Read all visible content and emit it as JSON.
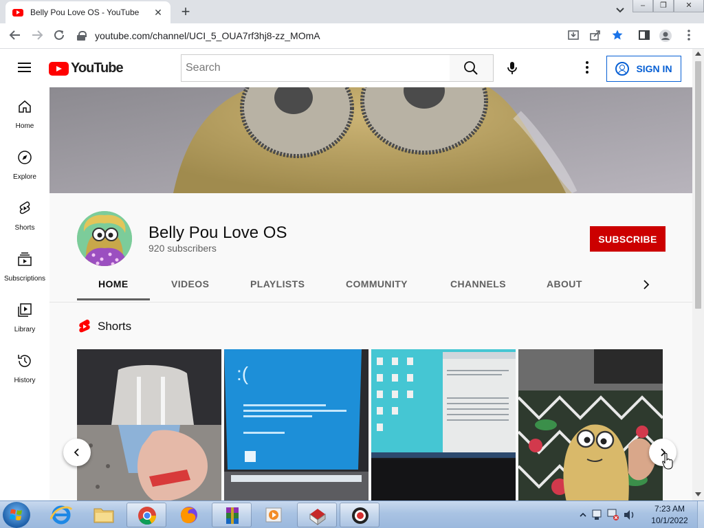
{
  "browser": {
    "tab_title": "Belly Pou Love OS - YouTube",
    "tab_close": "✕",
    "new_tab": "+",
    "url": "youtube.com/channel/UCI_5_OUA7rf3hj8-zz_MOmA"
  },
  "window_controls": {
    "minimize": "–",
    "restore": "❐",
    "close": "✕"
  },
  "youtube": {
    "logo_text": "YouTube",
    "search_placeholder": "Search",
    "sign_in": "SIGN IN"
  },
  "guide": [
    {
      "label": "Home",
      "icon": "home-icon"
    },
    {
      "label": "Explore",
      "icon": "compass-icon"
    },
    {
      "label": "Shorts",
      "icon": "shorts-icon"
    },
    {
      "label": "Subscriptions",
      "icon": "subscriptions-icon"
    },
    {
      "label": "Library",
      "icon": "library-icon"
    },
    {
      "label": "History",
      "icon": "history-icon"
    }
  ],
  "channel": {
    "name": "Belly Pou Love OS",
    "subscribers": "920 subscribers",
    "subscribe_label": "SUBSCRIBE",
    "tabs": [
      "HOME",
      "VIDEOS",
      "PLAYLISTS",
      "COMMUNITY",
      "CHANNELS",
      "ABOUT"
    ],
    "active_tab": "HOME"
  },
  "shorts": {
    "title": "Shorts",
    "thumbnails": 4
  },
  "taskbar": {
    "time": "7:23 AM",
    "date": "10/1/2022",
    "apps": [
      "internet-explorer",
      "file-explorer",
      "chrome",
      "firefox",
      "winrar",
      "media-player",
      "paint-app",
      "recorder-app"
    ]
  },
  "colors": {
    "youtube_red": "#ff0000",
    "subscribe_red": "#cc0000",
    "link_blue": "#065fd4"
  }
}
